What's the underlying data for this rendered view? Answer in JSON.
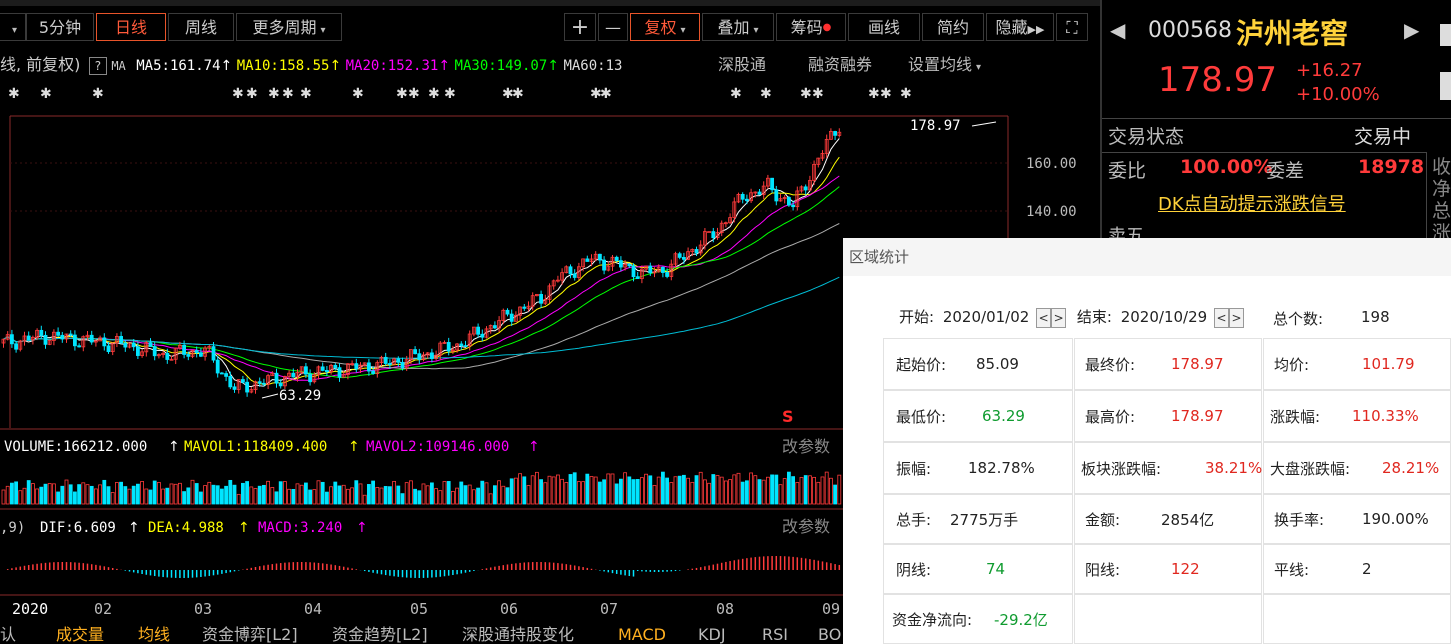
{
  "toolbar": {
    "items": [
      "5分钟",
      "日线",
      "周线",
      "更多周期",
      "+",
      "—",
      "复权",
      "叠加",
      "筹码",
      "画线",
      "简约",
      "隐藏",
      "⛶"
    ]
  },
  "ma_line": {
    "prefix": "线, 前复权)",
    "help": "?",
    "ma_tag": "MA",
    "ma5": "MA5:161.74",
    "ma10": "MA10:158.55",
    "ma20": "MA20:152.31",
    "ma30": "MA30:149.07",
    "ma60": "MA60:13",
    "link1": "深股通",
    "link2": "融资融券",
    "link3": "设置均线"
  },
  "chart": {
    "price_labels": [
      "160.00",
      "140.00"
    ],
    "high_label": "178.97",
    "low_label": "63.29",
    "marker_s": "S",
    "volume_text": "VOLUME:166212.000",
    "mavol1_text": "MAVOL1:118409.400",
    "mavol2_text": "MAVOL2:109146.000",
    "macd_prefix": ",9)",
    "dif_text": "DIF:6.609",
    "dea_text": "DEA:4.988",
    "macd_text": "MACD:3.240",
    "param_btn": "改参数",
    "x_labels": [
      "2020",
      "02",
      "03",
      "04",
      "05",
      "06",
      "07",
      "08",
      "09"
    ]
  },
  "bottom_tabs": [
    "认",
    "成交量",
    "均线",
    "资金博弈[L2]",
    "资金趋势[L2]",
    "深股通持股变化",
    "MACD",
    "KDJ",
    "RSI",
    "BO"
  ],
  "stock": {
    "code": "000568",
    "name": "泸州老窖",
    "price": "178.97",
    "change": "+16.27",
    "change_pct": "+10.00%",
    "trade_status_label": "交易状态",
    "trade_status": "交易中",
    "weibi_label": "委比",
    "weibi": "100.00%",
    "weicha_label": "委差",
    "weicha": "18978",
    "dk_link": "DK点自动提示涨跌信号",
    "sell5": "卖五",
    "side_chars": "收净总涨"
  },
  "dialog": {
    "title": "区域统计",
    "start_label": "开始:",
    "start_date": "2020/01/02",
    "end_label": "结束:",
    "end_date": "2020/10/29",
    "total_label": "总个数:",
    "total": "198",
    "open_label": "起始价:",
    "open": "85.09",
    "close_label": "最终价:",
    "close": "178.97",
    "avg_label": "均价:",
    "avg": "101.79",
    "low_label": "最低价:",
    "low": "63.29",
    "high_label": "最高价:",
    "high": "178.97",
    "chg_label": "涨跌幅:",
    "chg": "110.33%",
    "amp_label": "振幅:",
    "amp": "182.78%",
    "sector_label": "板块涨跌幅:",
    "sector": "38.21%",
    "market_label": "大盘涨跌幅:",
    "market": "28.21%",
    "vol_label": "总手:",
    "vol": "2775万手",
    "amt_label": "金额:",
    "amt": "2854亿",
    "turn_label": "换手率:",
    "turn": "190.00%",
    "yin_label": "阴线:",
    "yin": "74",
    "yang_label": "阳线:",
    "yang": "122",
    "flat_label": "平线:",
    "flat": "2",
    "flow_label": "资金净流向:",
    "flow": "-29.2亿"
  },
  "colors": {
    "up": "#ff3b3b",
    "down": "#00e5ff",
    "ma5": "#ffffff",
    "ma10": "#ffff00",
    "ma20": "#ff00ff",
    "ma30": "#00ff00",
    "ma60": "#aaaaaa"
  }
}
